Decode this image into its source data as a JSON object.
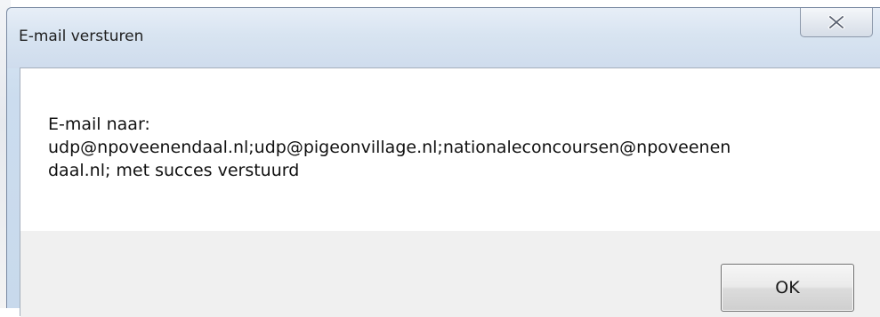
{
  "window": {
    "title": "E-mail versturen",
    "close_icon": "close-x-icon"
  },
  "message": {
    "text": "E-mail naar:\nudp@npoveenendaal.nl;udp@pigeonvillage.nl;nationaleconcoursen@npoveenen\ndaal.nl; met succes verstuurd"
  },
  "buttons": {
    "ok_label": "OK"
  }
}
